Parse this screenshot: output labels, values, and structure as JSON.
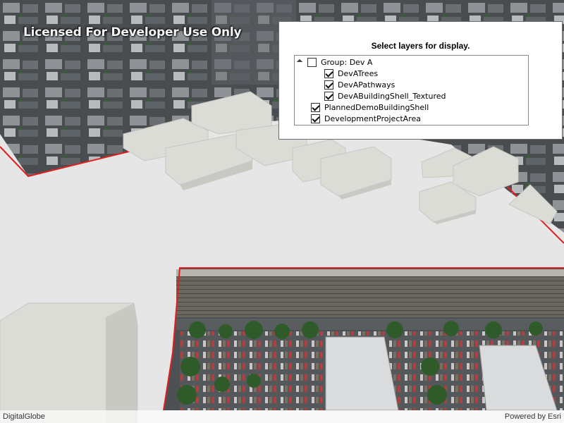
{
  "scene": {
    "watermark": "Licensed For Developer Use Only",
    "attribution_left": "DigitalGlobe",
    "attribution_right": "Powered by Esri"
  },
  "layer_panel": {
    "title": "Select layers for display.",
    "layers": [
      {
        "label": "Group: Dev A",
        "checked": false,
        "expander": true
      },
      {
        "label": "DevATrees",
        "checked": true
      },
      {
        "label": "DevAPathways",
        "checked": true
      },
      {
        "label": "DevABuildingShell_Textured",
        "checked": true
      },
      {
        "label": "PlannedDemoBuildingShell",
        "checked": true
      },
      {
        "label": "DevelopmentProjectArea",
        "checked": true
      }
    ]
  },
  "colors": {
    "project_area_outline": "#e02020",
    "ground": "#e6e6e6",
    "building_shell": "#dcdcd7"
  }
}
